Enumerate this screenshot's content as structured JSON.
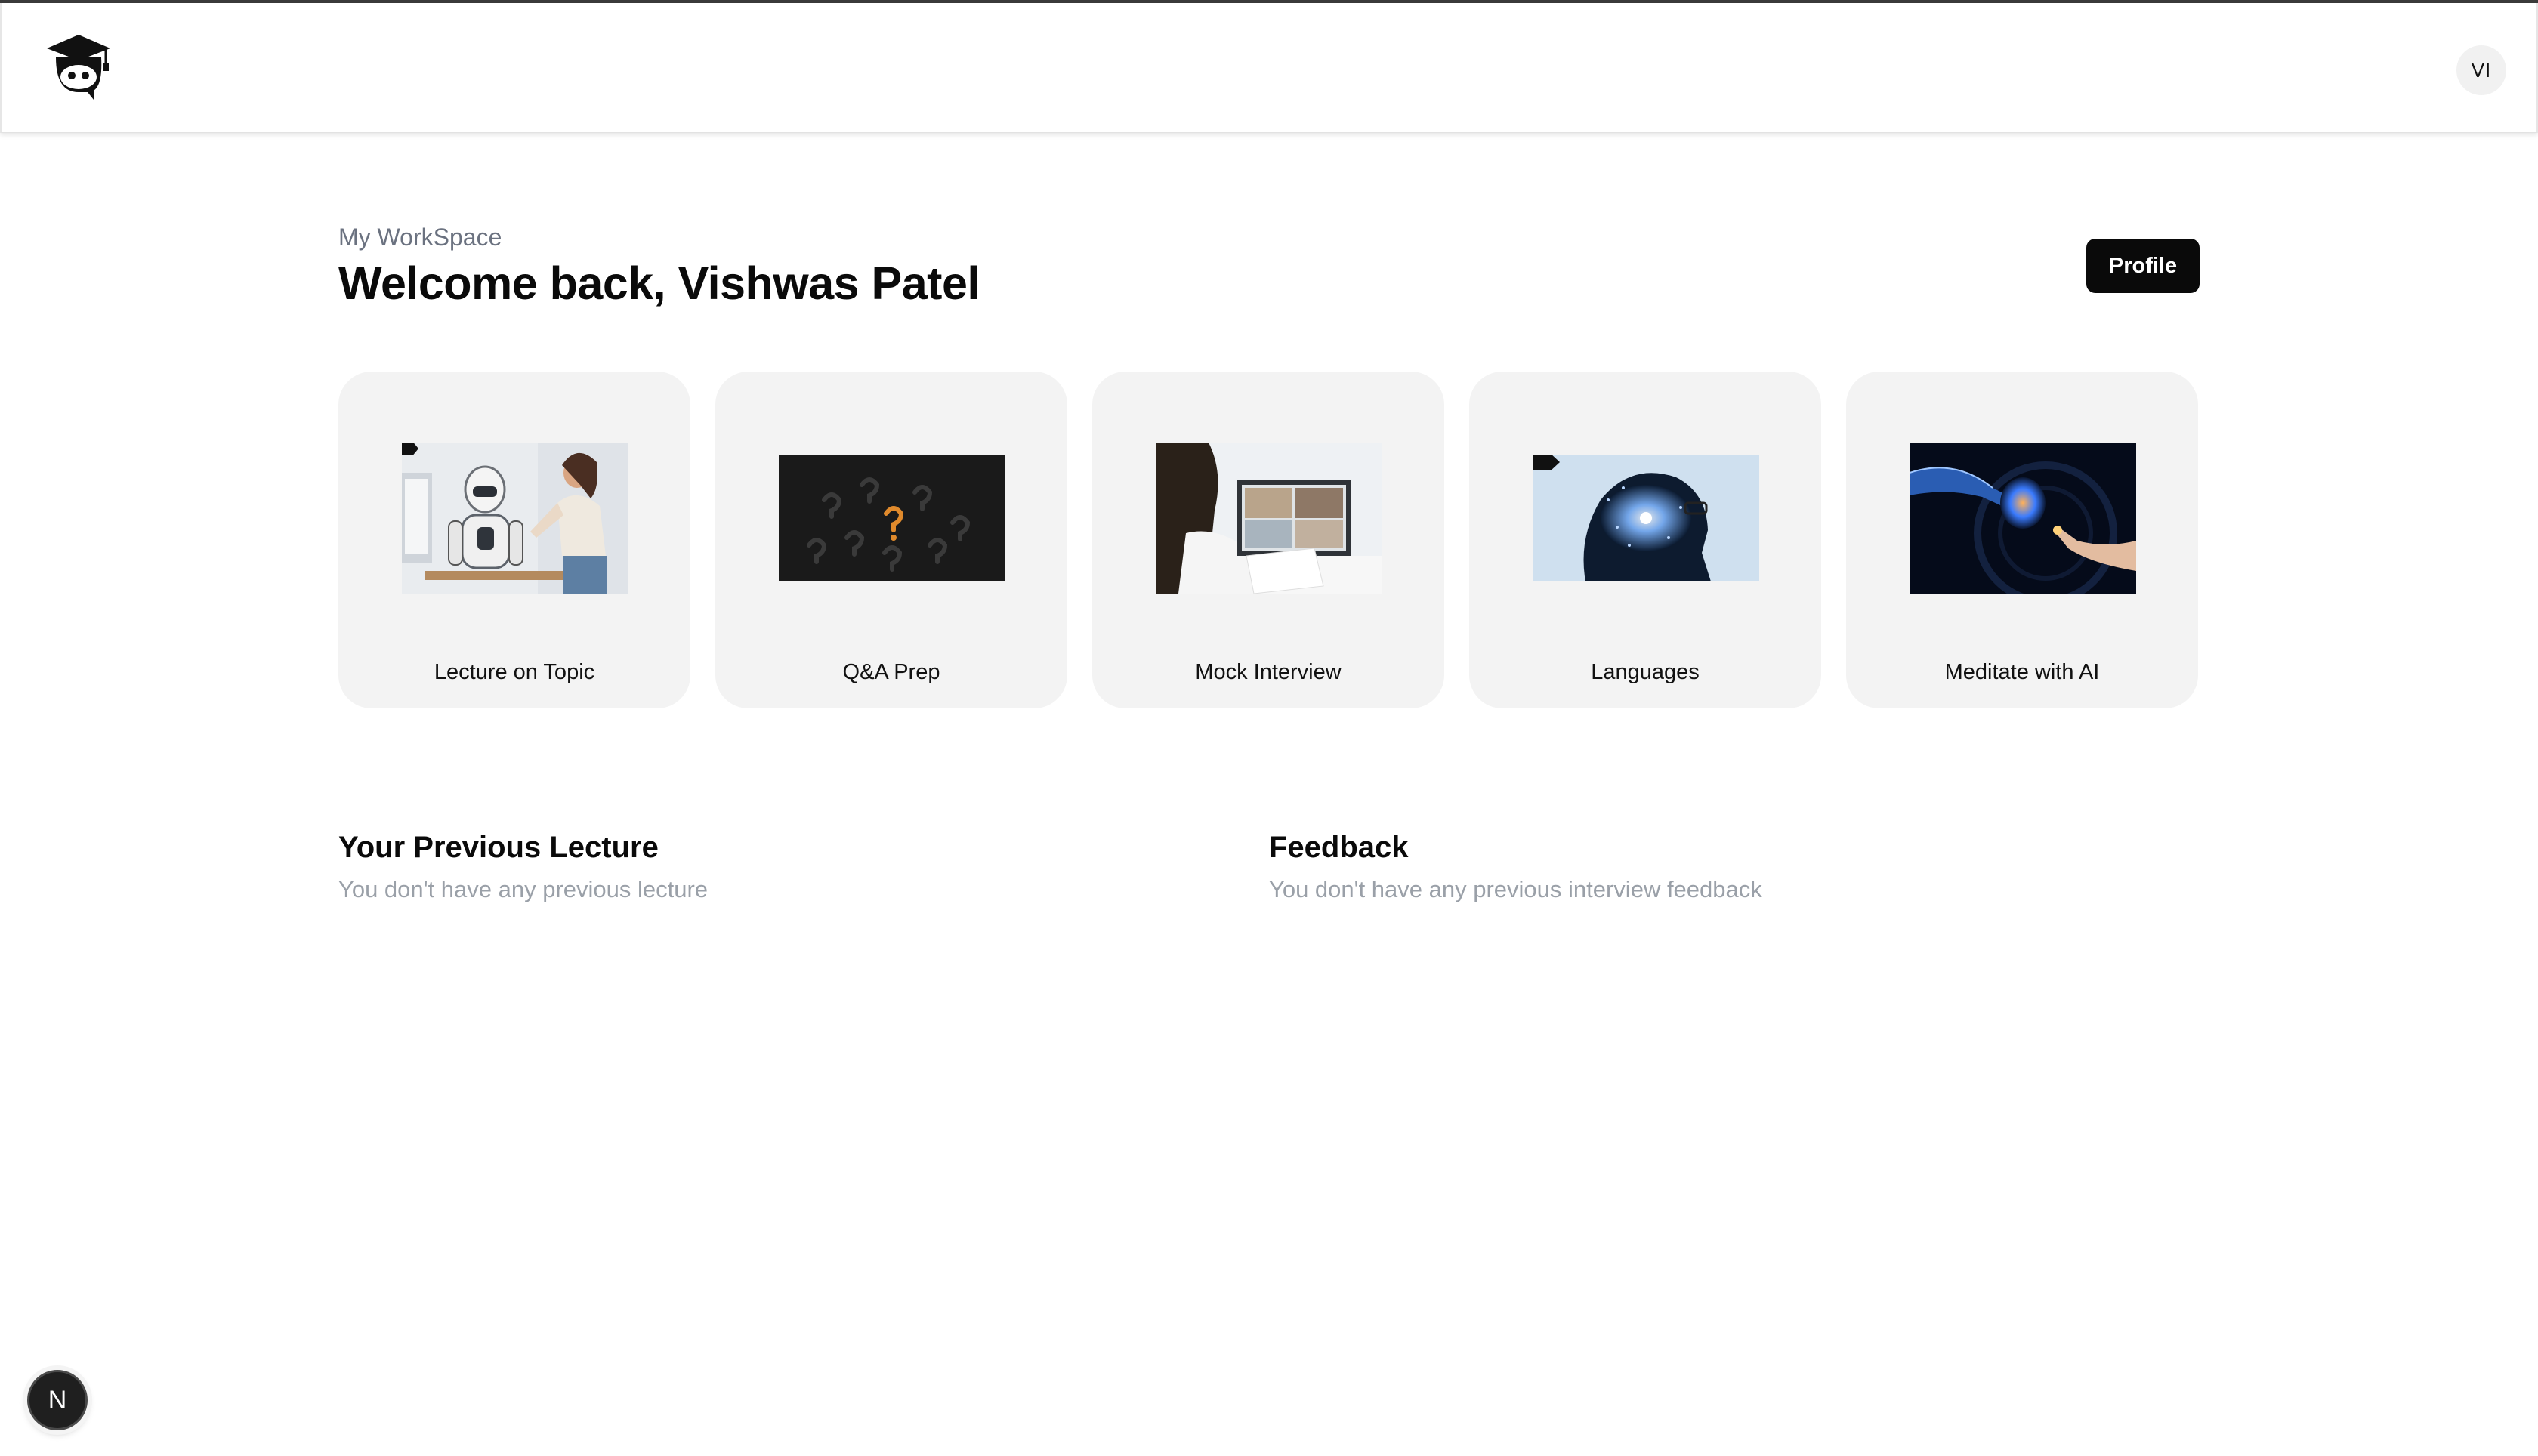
{
  "header": {
    "logo_icon": "mascot-graduation-cap-icon",
    "avatar_initials": "VI"
  },
  "workspace": {
    "label": "My WorkSpace",
    "greeting": "Welcome back, Vishwas Patel",
    "profile_button": "Profile"
  },
  "cards": [
    {
      "label": "Lecture on Topic",
      "image": "robot-and-woman-at-computer"
    },
    {
      "label": "Q&A Prep",
      "image": "question-marks-dark"
    },
    {
      "label": "Mock Interview",
      "image": "video-call-interview"
    },
    {
      "label": "Languages",
      "image": "digital-head-silhouette"
    },
    {
      "label": "Meditate with AI",
      "image": "robot-hand-touching-brain"
    }
  ],
  "sections": {
    "previous_lecture": {
      "title": "Your Previous Lecture",
      "empty_text": "You don't have any previous lecture"
    },
    "feedback": {
      "title": "Feedback",
      "empty_text": "You don't have any previous interview feedback"
    }
  },
  "dev_badge": {
    "letter": "N"
  }
}
